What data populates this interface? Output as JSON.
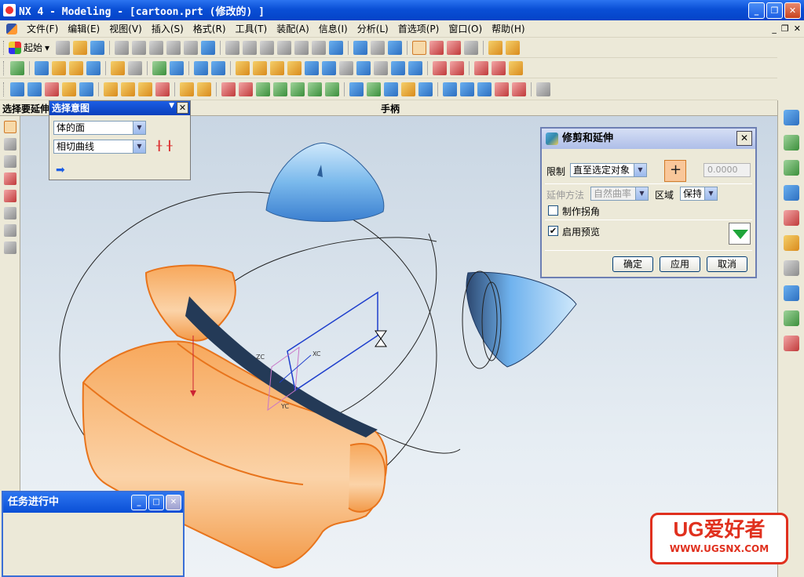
{
  "window": {
    "title": "NX 4 - Modeling - [cartoon.prt  (修改的) ]"
  },
  "menu": [
    "文件(F)",
    "编辑(E)",
    "视图(V)",
    "插入(S)",
    "格式(R)",
    "工具(T)",
    "装配(A)",
    "信息(I)",
    "分析(L)",
    "首选项(P)",
    "窗口(O)",
    "帮助(H)"
  ],
  "toolbar": {
    "start_label": "起始"
  },
  "cue": {
    "prompt": "选择要延伸",
    "status": "手柄"
  },
  "selection_intent": {
    "title": "选择意图",
    "face_rule": "体的面",
    "curve_rule": "相切曲线"
  },
  "trim_extend": {
    "title": "修剪和延伸",
    "limit_label": "限制",
    "limit_value": "直至选定对象",
    "distance_value": "0.0000",
    "extend_method_label": "延伸方法",
    "extend_method_value": "自然曲率",
    "region_label": "区域",
    "region_value": "保持",
    "corner_label": "制作拐角",
    "corner_checked": false,
    "preview_label": "启用预览",
    "preview_checked": true,
    "ok": "确定",
    "apply": "应用",
    "cancel": "取消"
  },
  "task_window": {
    "title": "任务进行中"
  },
  "viewport": {
    "axis_labels": [
      "ZC",
      "YC",
      "XC"
    ]
  },
  "watermark": {
    "logo_text": "UG爱好者",
    "url": "WWW.UGSNX.COM"
  },
  "colors": {
    "titlebar": "#0a4fd6",
    "model_orange": "#f7a85c",
    "model_blue": "#5fa8e8"
  }
}
